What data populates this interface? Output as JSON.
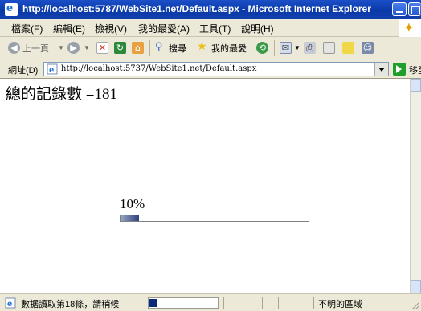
{
  "window": {
    "title": "http://localhost:5787/WebSite1.net/Default.aspx - Microsoft Internet Explorer"
  },
  "menu": {
    "items": [
      "檔案(F)",
      "編輯(E)",
      "檢視(V)",
      "我的最愛(A)",
      "工具(T)",
      "說明(H)"
    ]
  },
  "toolbar": {
    "back_label": "上一頁",
    "search_label": "搜尋",
    "favorites_label": "我的最愛"
  },
  "address": {
    "label": "網址(D)",
    "url": "http://localhost:5737/WebSite1.net/Default.aspx",
    "go_label": "移至"
  },
  "content": {
    "record_count_text": "總的記錄數 =181",
    "progress_percent_text": "10%",
    "progress_value": 0.1
  },
  "status": {
    "message": "數据讀取第18條，請稍候",
    "zone": "不明的區域",
    "progress_value": 0.12
  },
  "colors": {
    "titlebar": "#0a3aa8",
    "chrome": "#ece9d8",
    "progress_fill": "#2f3f7c"
  }
}
